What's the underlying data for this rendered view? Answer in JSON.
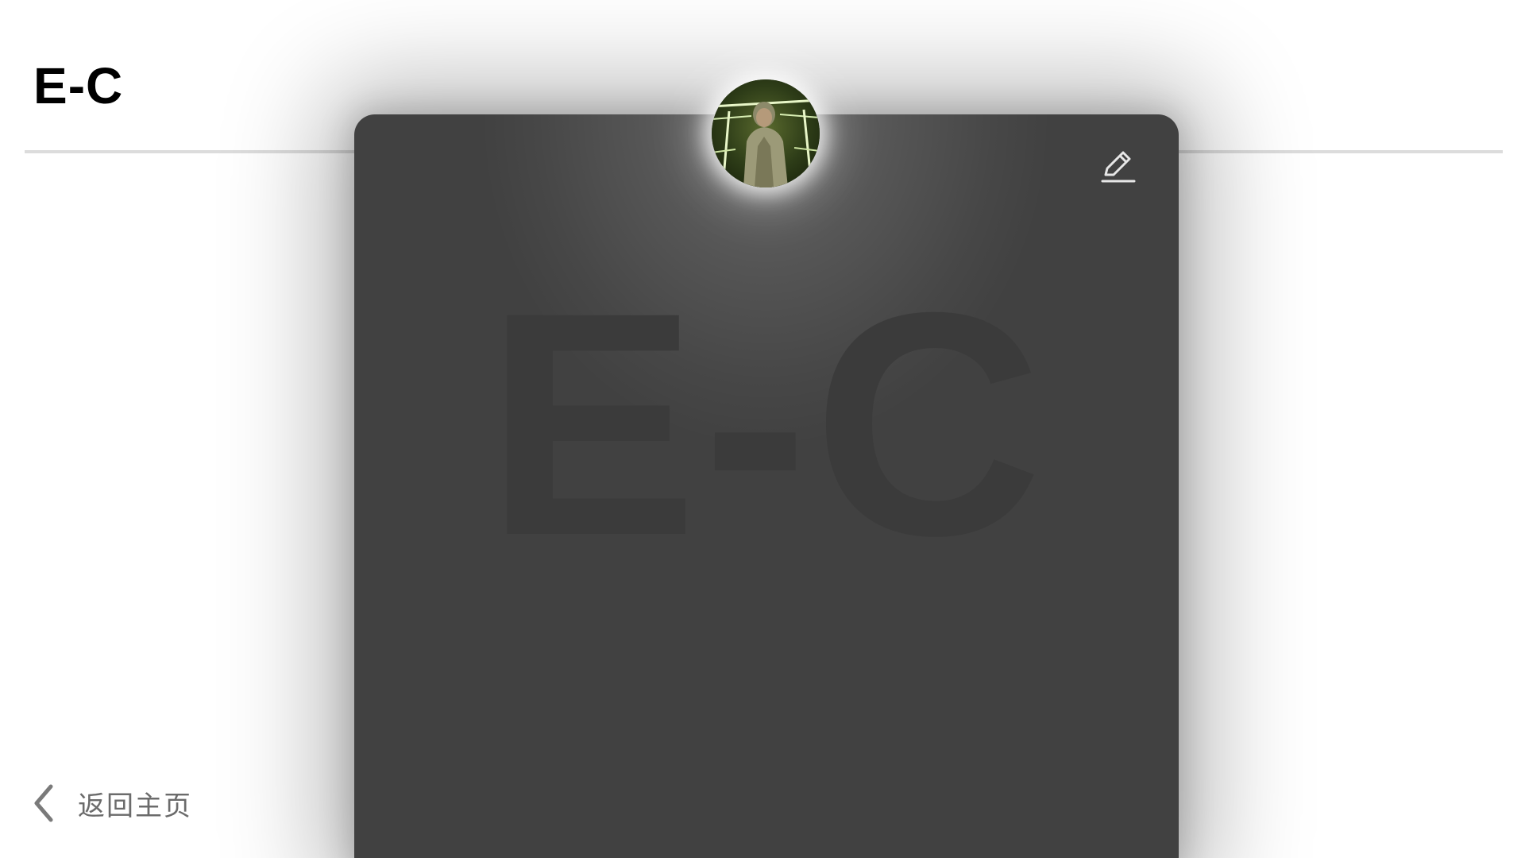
{
  "header": {
    "brand": "E-C"
  },
  "card": {
    "watermark": "E-C",
    "background_color": "#414141",
    "edit_icon": "pencil-edit-icon"
  },
  "avatar": {
    "image": "user-avatar-photo"
  },
  "footer": {
    "back_label": "返回主页",
    "back_icon": "chevron-left-icon"
  },
  "colors": {
    "page_background": "#ffffff",
    "brand_text": "#000000",
    "divider": "#dcdcdc",
    "back_text": "#6b6b6b"
  }
}
